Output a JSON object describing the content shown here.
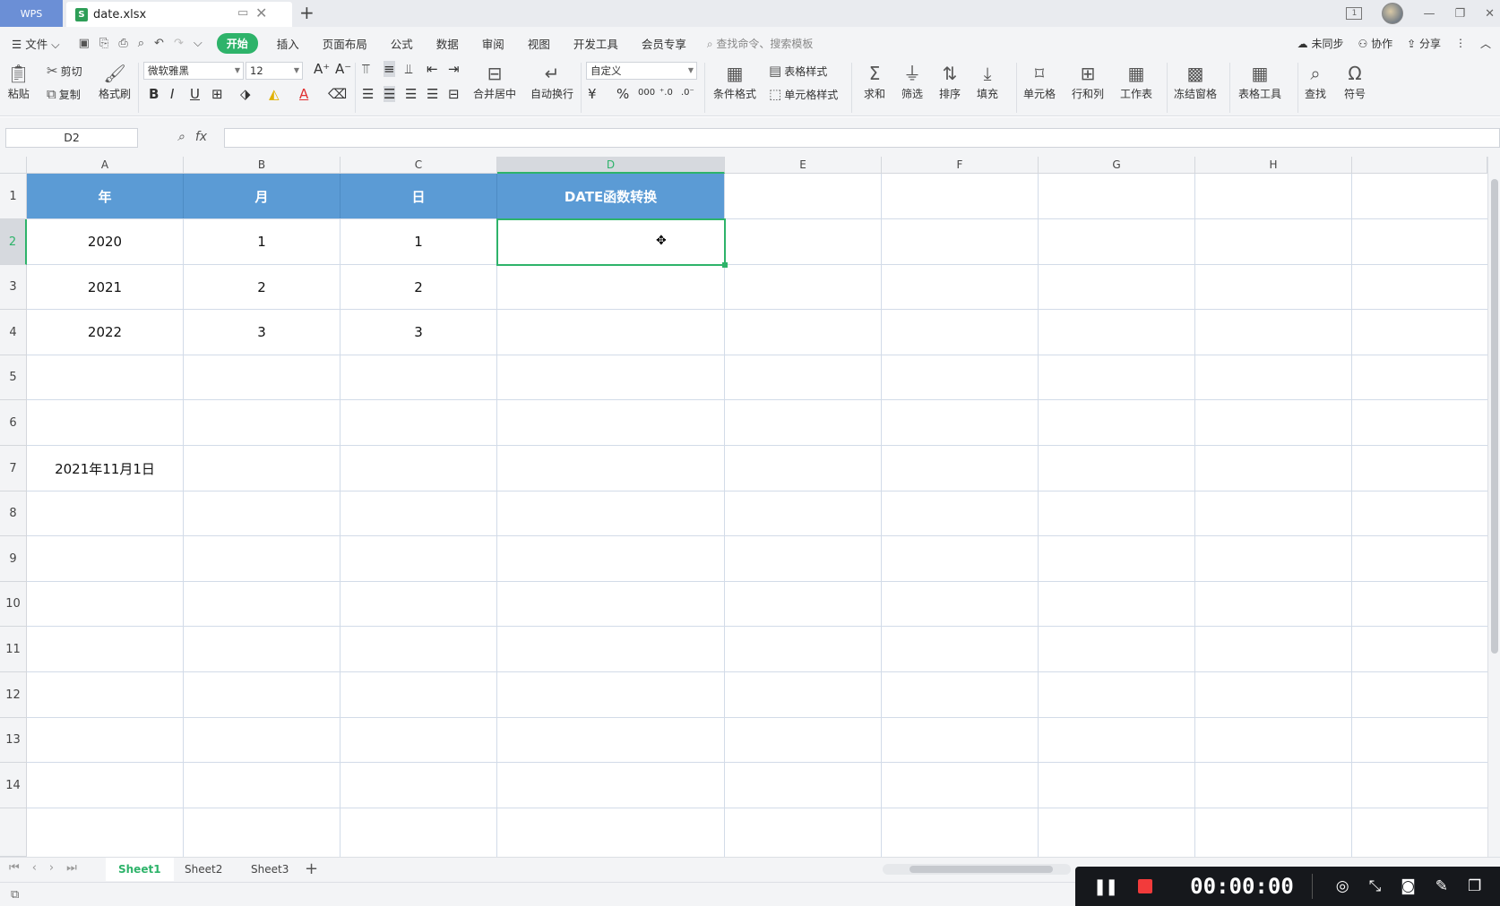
{
  "titlebar": {
    "wps_label": "WPS",
    "doc_name": "date.xlsx",
    "xls_badge": "S",
    "badge_num": "1"
  },
  "menubar": {
    "file_label": "文件",
    "items": [
      "开始",
      "插入",
      "页面布局",
      "公式",
      "数据",
      "审阅",
      "视图",
      "开发工具",
      "会员专享"
    ],
    "search_placeholder": "查找命令、搜索模板",
    "right": {
      "sync": "未同步",
      "collab": "协作",
      "share": "分享"
    }
  },
  "ribbon": {
    "paste": "粘贴",
    "cut": "剪切",
    "copy": "复制",
    "format_painter": "格式刷",
    "font_name": "微软雅黑",
    "font_size": "12",
    "merge_center": "合并居中",
    "wrap_text": "自动换行",
    "number_format": "自定义",
    "cond_format": "条件格式",
    "table_style": "表格样式",
    "cell_style": "单元格样式",
    "sum": "求和",
    "filter": "筛选",
    "sort": "排序",
    "fill": "填充",
    "cells": "单元格",
    "rows_cols": "行和列",
    "worksheet": "工作表",
    "freeze": "冻结窗格",
    "table_tools": "表格工具",
    "find": "查找",
    "symbol": "符号"
  },
  "formula_bar": {
    "name_box": "D2",
    "fx": "fx",
    "value": ""
  },
  "grid": {
    "columns": [
      "A",
      "B",
      "C",
      "D",
      "E",
      "F",
      "G",
      "H"
    ],
    "selected_column": "D",
    "rows": [
      "1",
      "2",
      "3",
      "4",
      "5",
      "6",
      "7",
      "8",
      "9",
      "10",
      "11",
      "12",
      "13",
      "14"
    ],
    "selected_row": "2",
    "header_row": [
      "年",
      "月",
      "日",
      "DATE函数转换"
    ],
    "data_rows": [
      [
        "2020",
        "1",
        "1",
        ""
      ],
      [
        "2021",
        "2",
        "2",
        ""
      ],
      [
        "2022",
        "3",
        "3",
        ""
      ]
    ],
    "a7": "2021年11月1日",
    "header_fill_color": "#5b9bd5",
    "selection_color": "#2eb36a"
  },
  "sheets": {
    "tabs": [
      "Sheet1",
      "Sheet2",
      "Sheet3"
    ],
    "active": "Sheet1"
  },
  "recorder": {
    "time": "00:00:00"
  }
}
